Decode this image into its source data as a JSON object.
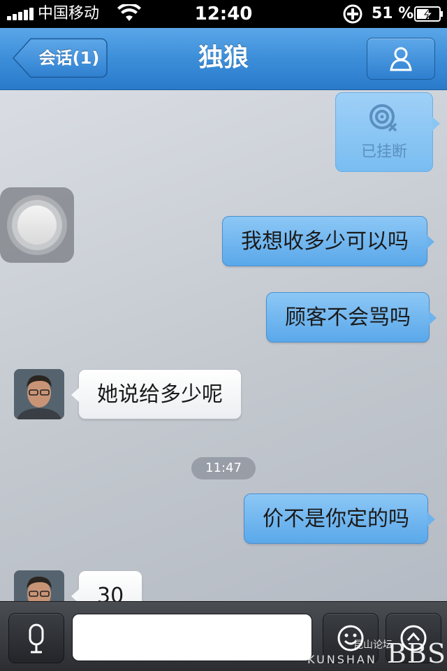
{
  "status_bar": {
    "carrier": "中国移动",
    "time": "12:40",
    "battery_percent": "51 %"
  },
  "nav": {
    "back_label": "会话(1)",
    "title": "独狼",
    "profile_icon": "person-icon"
  },
  "chat": {
    "call_status": "已挂断",
    "messages": [
      {
        "direction": "out",
        "text": "我想收多少可以吗"
      },
      {
        "direction": "out",
        "text": "顾客不会骂吗"
      },
      {
        "direction": "in",
        "text": "她说给多少呢"
      },
      {
        "direction": "out",
        "text": "价不是你定的吗"
      },
      {
        "direction": "in",
        "text": "30"
      }
    ],
    "timestamp": "11:47"
  },
  "input_bar": {
    "voice_icon": "microphone-icon",
    "emoji_icon": "smiley-icon",
    "more_icon": "plus-icon",
    "message_value": ""
  },
  "watermark": {
    "cn": "昆山论坛",
    "en": "KUNSHAN",
    "bbs": "BBS"
  },
  "colors": {
    "nav_blue": "#3c8ed9",
    "outgoing_bubble": "#6db3ee",
    "incoming_bubble": "#ffffff"
  }
}
